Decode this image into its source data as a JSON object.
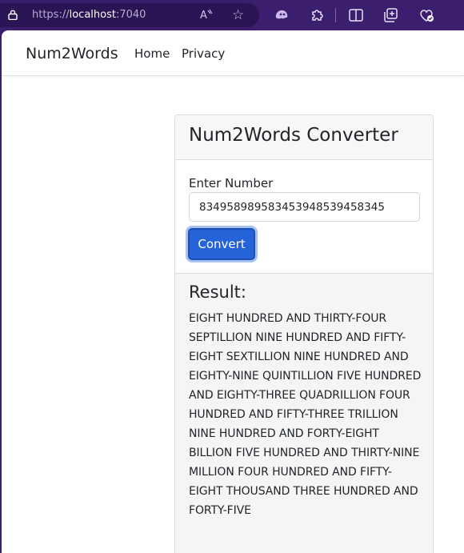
{
  "browser": {
    "url_scheme": "https://",
    "url_host": "localhost",
    "url_port": ":7040",
    "read_aloud_glyph": "A̅̅",
    "icons": [
      "lock-icon",
      "read-aloud-icon",
      "favorite-star-icon",
      "copilot-icon",
      "extensions-icon",
      "split-screen-icon",
      "collections-icon",
      "browser-essentials-icon"
    ]
  },
  "navbar": {
    "brand": "Num2Words",
    "links": [
      "Home",
      "Privacy"
    ]
  },
  "converter": {
    "title": "Num2Words Converter",
    "input_label": "Enter Number",
    "input_value": "834958989583453948539458345",
    "button_label": "Convert",
    "result_title": "Result:",
    "result_text": "EIGHT HUNDRED AND THIRTY-FOUR SEPTILLION NINE HUNDRED AND FIFTY-EIGHT SEXTILLION NINE HUNDRED AND EIGHTY-NINE QUINTILLION FIVE HUNDRED AND EIGHTY-THREE QUADRILLION FOUR HUNDRED AND FIFTY-THREE TRILLION NINE HUNDRED AND FORTY-EIGHT BILLION FIVE HUNDRED AND THIRTY-NINE MILLION FOUR HUNDRED AND FIFTY-EIGHT THOUSAND THREE HUNDRED AND FORTY-FIVE"
  },
  "colors": {
    "browser_frame": "#3b1f6e",
    "primary_button": "#2563d9"
  }
}
